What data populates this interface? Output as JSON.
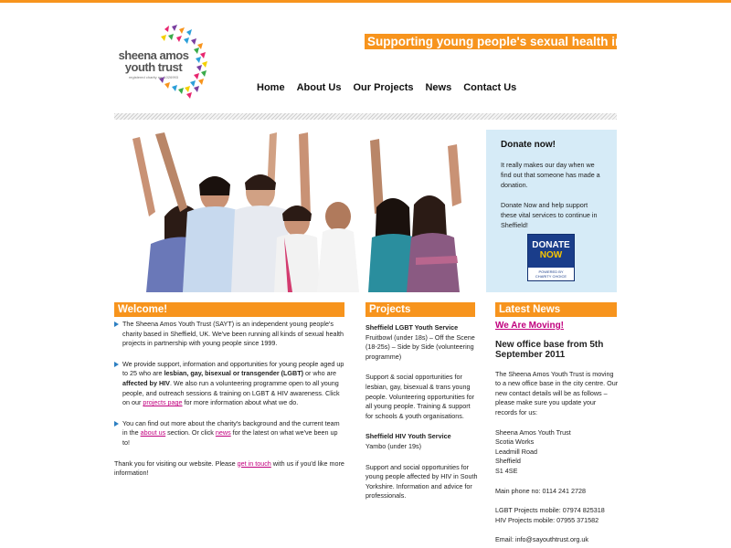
{
  "logo": {
    "line1": "sheena amos",
    "line2": "youth trust",
    "line3": "registered charity no. 1026993"
  },
  "tagline": "Supporting young people's sexual health in Sheffield.",
  "nav": [
    {
      "label": "Home"
    },
    {
      "label": "About Us"
    },
    {
      "label": "Our Projects"
    },
    {
      "label": "News"
    },
    {
      "label": "Contact Us"
    }
  ],
  "donate": {
    "title": "Donate now!",
    "p1": "It really makes our day when we find out that someone has made a donation.",
    "p2": "Donate Now and help support these vital services to continue in Sheffield!",
    "btn_line1": "DONATE",
    "btn_line2": "NOW",
    "btn_powered": "POWERED BY",
    "btn_brand": "CHARITY CHOICE"
  },
  "welcome": {
    "heading": "Welcome!",
    "item1": "The Sheena Amos Youth Trust (SAYT) is an independent young people's charity based in Sheffield, UK. We've been running all kinds of sexual health projects in partnership with young people since 1999.",
    "item2_a": "We provide support, information and opportunities for young people aged up to 25 who are ",
    "item2_b": "lesbian, gay, bisexual or transgender (LGBT)",
    "item2_c": " or who are ",
    "item2_d": "affected by HIV",
    "item2_e": ". We also run a volunteering programme open to all young people, and outreach sessions & training on LGBT & HIV awareness. Click on our ",
    "item2_link": "projects page",
    "item2_f": " for more information about what we do.",
    "item3_a": "You can find out more about the charity's background and the current team in the ",
    "item3_link1": "about us",
    "item3_b": " section. Or click ",
    "item3_link2": "news",
    "item3_c": " for the latest on what we've been up to!",
    "closing_a": "Thank you for visiting our website. Please ",
    "closing_link": "get in touch",
    "closing_b": " with us if you'd like more information!"
  },
  "projects": {
    "heading": "Projects",
    "p1_title": "Sheffield LGBT Youth Service",
    "p1_sub": "Fruitbowl (under 18s) – Off the Scene (18-25s) – Side by Side (volunteering programme)",
    "p1_desc": "Support & social opportunities for lesbian, gay, bisexual & trans young people. Volunteering opportunities for all young people. Training & support for schools & youth organisations.",
    "p2_title": "Sheffield HIV Youth Service",
    "p2_sub": "Yambo (under 19s)",
    "p2_desc": "Support and social opportunities for young people affected by HIV in South Yorkshire. Information and advice for professionals."
  },
  "news": {
    "heading": "Latest News",
    "moving": "We Are Moving!",
    "office": "New office base from 5th September 2011",
    "p1": "The Sheena Amos Youth Trust is moving to a new office base in the city centre. Our new contact details will be as follows – please make sure you update your records for us:",
    "addr1": "Sheena Amos Youth Trust",
    "addr2": "Scotia Works",
    "addr3": "Leadmill Road",
    "addr4": "Sheffield",
    "addr5": "S1 4SE",
    "phone": "Main phone no: 0114 241 2728",
    "lgbt_mobile": "LGBT Projects mobile: 07974 825318",
    "hiv_mobile": "HIV Projects mobile: 07955 371582",
    "email": "Email: info@sayouthtrust.org.uk"
  },
  "colors": {
    "accent": "#f7941d",
    "link": "#c1007e",
    "donate_bg": "#d6ebf7"
  }
}
